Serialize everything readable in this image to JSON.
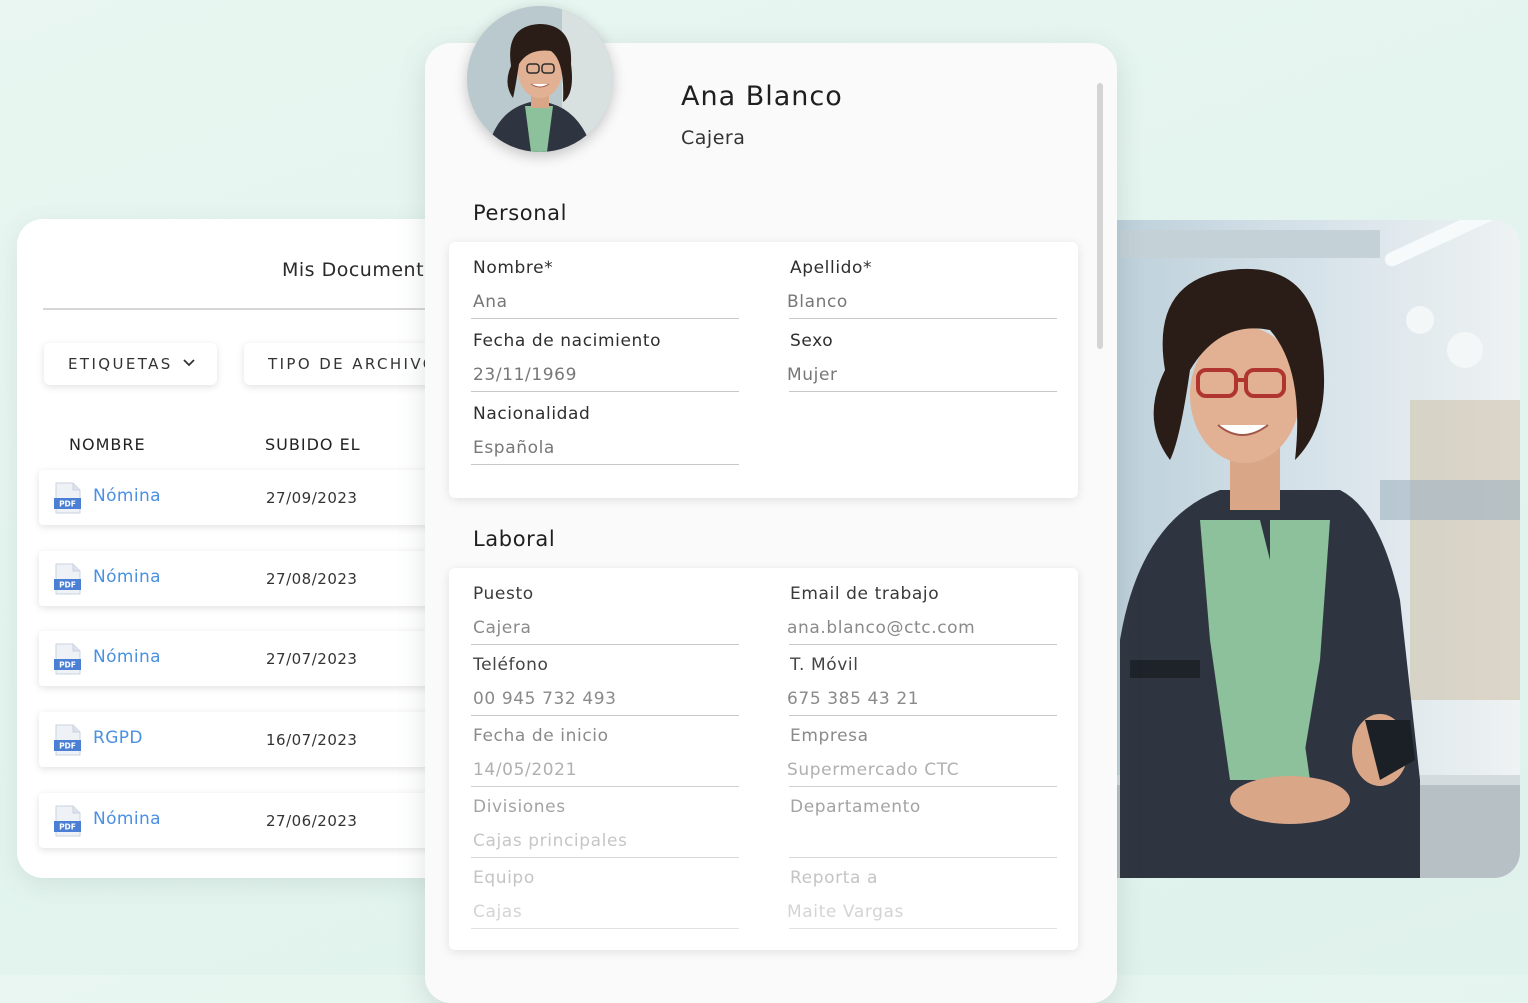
{
  "documents": {
    "title": "Mis Documentos",
    "filters": [
      "ETIQUETAS",
      "TIPO DE ARCHIVO"
    ],
    "columns": [
      "NOMBRE",
      "SUBIDO EL"
    ],
    "rows": [
      {
        "name": "Nómina",
        "date": "27/09/2023"
      },
      {
        "name": "Nómina",
        "date": "27/08/2023"
      },
      {
        "name": "Nómina",
        "date": "27/07/2023"
      },
      {
        "name": "RGPD",
        "date": "16/07/2023"
      },
      {
        "name": "Nómina",
        "date": "27/06/2023"
      }
    ],
    "file_icon": "pdf-file-icon",
    "pdf_badge": "PDF"
  },
  "profile": {
    "name": "Ana Blanco",
    "role": "Cajera",
    "personal": {
      "title": "Personal",
      "fields": [
        {
          "label": "Nombre*",
          "value": "Ana"
        },
        {
          "label": "Apellido*",
          "value": "Blanco"
        },
        {
          "label": "Fecha de nacimiento",
          "value": "23/11/1969"
        },
        {
          "label": "Sexo",
          "value": "Mujer"
        },
        {
          "label": "Nacionalidad",
          "value": "Española"
        }
      ]
    },
    "laboral": {
      "title": "Laboral",
      "fields": [
        {
          "label": "Puesto",
          "value": "Cajera"
        },
        {
          "label": "Email de trabajo",
          "value": "ana.blanco@ctc.com"
        },
        {
          "label": "Teléfono",
          "value": "00 945 732 493"
        },
        {
          "label": "T. Móvil",
          "value": "675 385 43 21"
        },
        {
          "label": "Fecha de inicio",
          "value": "14/05/2021"
        },
        {
          "label": "Empresa",
          "value": "Supermercado CTC"
        },
        {
          "label": "Divisiones",
          "value": "Cajas principales"
        },
        {
          "label": "Departamento",
          "value": ""
        },
        {
          "label": "Equipo",
          "value": "Cajas"
        },
        {
          "label": "Reporta a",
          "value": "Maite Vargas"
        }
      ]
    }
  },
  "colors": {
    "accent_link": "#4a90e2",
    "background": "#e3f4ee"
  }
}
